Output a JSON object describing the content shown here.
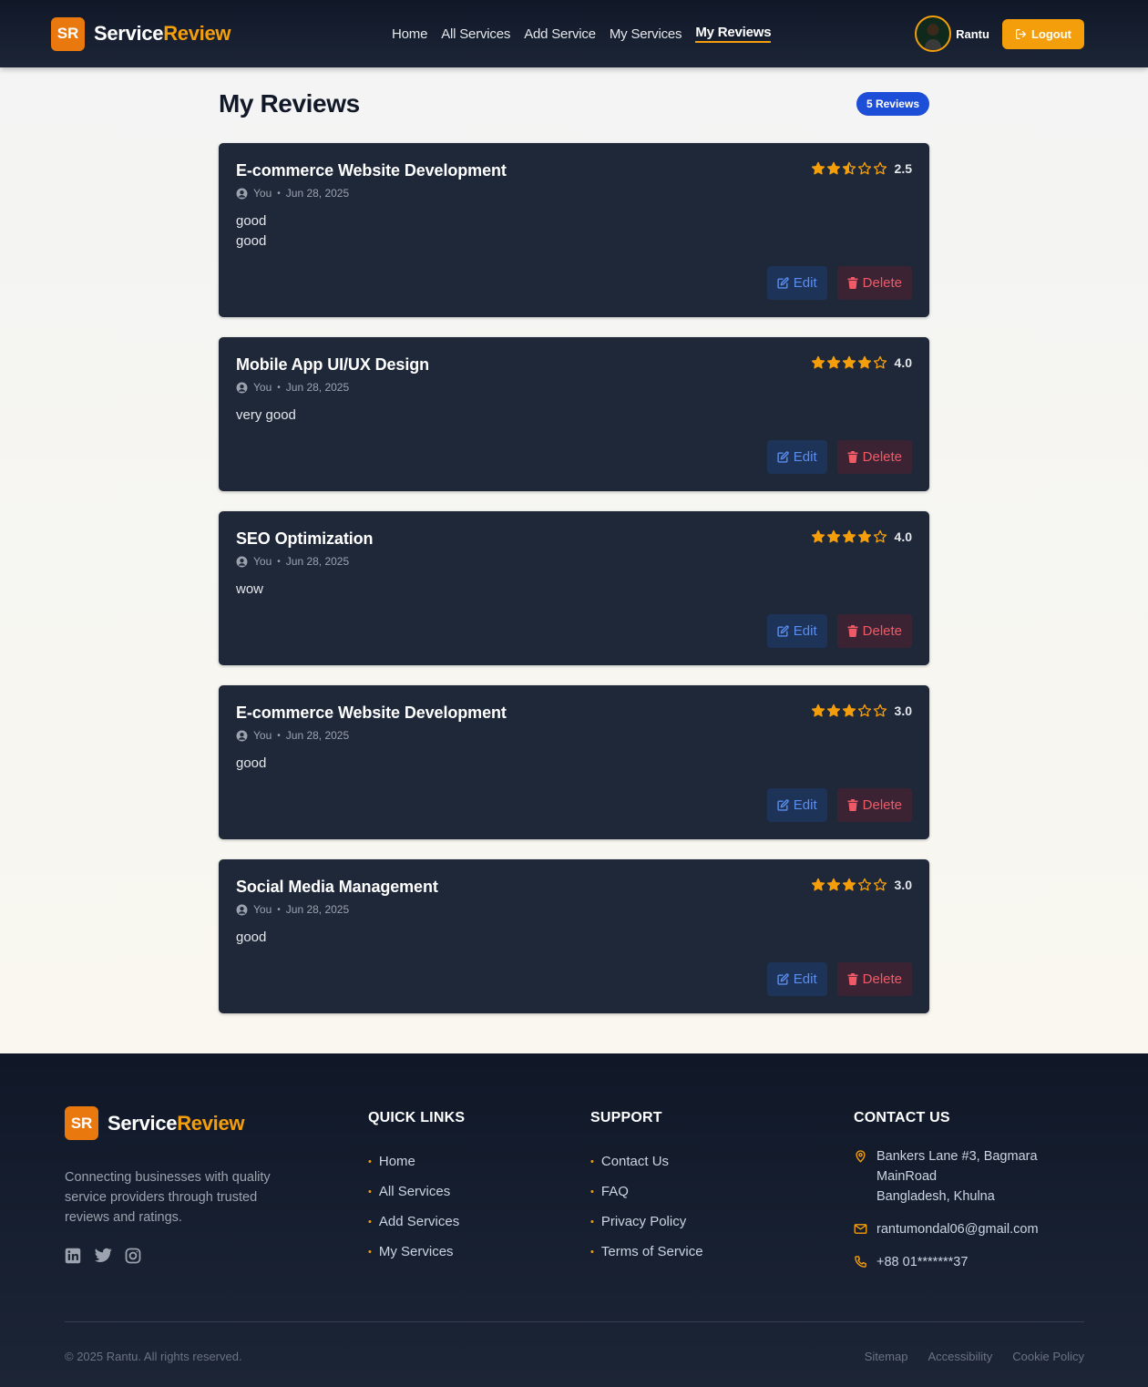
{
  "brand": {
    "badge": "SR",
    "name_primary": "Service",
    "name_accent": "Review"
  },
  "nav": {
    "links": [
      "Home",
      "All Services",
      "Add Service",
      "My Services",
      "My Reviews"
    ],
    "active": "My Reviews"
  },
  "user": {
    "name": "Rantu",
    "logout_label": "Logout"
  },
  "page": {
    "title": "My Reviews",
    "count_badge": "5 Reviews"
  },
  "reviews": [
    {
      "service": "E-commerce Website Development",
      "author": "You",
      "date": "Jun 28, 2025",
      "comment": "good\ngood",
      "rating": 2.5,
      "rating_text": "2.5"
    },
    {
      "service": "Mobile App UI/UX Design",
      "author": "You",
      "date": "Jun 28, 2025",
      "comment": "very good",
      "rating": 4,
      "rating_text": "4.0"
    },
    {
      "service": "SEO Optimization",
      "author": "You",
      "date": "Jun 28, 2025",
      "comment": "wow",
      "rating": 4,
      "rating_text": "4.0"
    },
    {
      "service": "E-commerce Website Development",
      "author": "You",
      "date": "Jun 28, 2025",
      "comment": "good",
      "rating": 3,
      "rating_text": "3.0"
    },
    {
      "service": "Social Media Management",
      "author": "You",
      "date": "Jun 28, 2025",
      "comment": "good",
      "rating": 3,
      "rating_text": "3.0"
    }
  ],
  "card_actions": {
    "edit_label": "Edit",
    "delete_label": "Delete"
  },
  "footer": {
    "description": "Connecting businesses with quality service providers through trusted reviews and ratings.",
    "social_icons": [
      "linkedin-icon",
      "twitter-icon",
      "instagram-icon"
    ],
    "quick_links": {
      "heading": "QUICK LINKS",
      "items": [
        "Home",
        "All Services",
        "Add Services",
        "My Services"
      ]
    },
    "support": {
      "heading": "SUPPORT",
      "items": [
        "Contact Us",
        "FAQ",
        "Privacy Policy",
        "Terms of Service"
      ]
    },
    "contact": {
      "heading": "CONTACT US",
      "address": "Bankers Lane #3, Bagmara MainRoad\nBangladesh, Khulna",
      "email": "rantumondal06@gmail.com",
      "phone": "+88 01*******37"
    },
    "copyright": "© 2025 Rantu. All rights reserved.",
    "bottom_links": [
      "Sitemap",
      "Accessibility",
      "Cookie Policy"
    ]
  },
  "colors": {
    "accent": "#f59e0b",
    "nav_bg": "#101828",
    "card_bg": "#1f2839",
    "badge_blue": "#1d4ed8",
    "edit_text": "#5b8def",
    "delete_text": "#f05a67"
  }
}
